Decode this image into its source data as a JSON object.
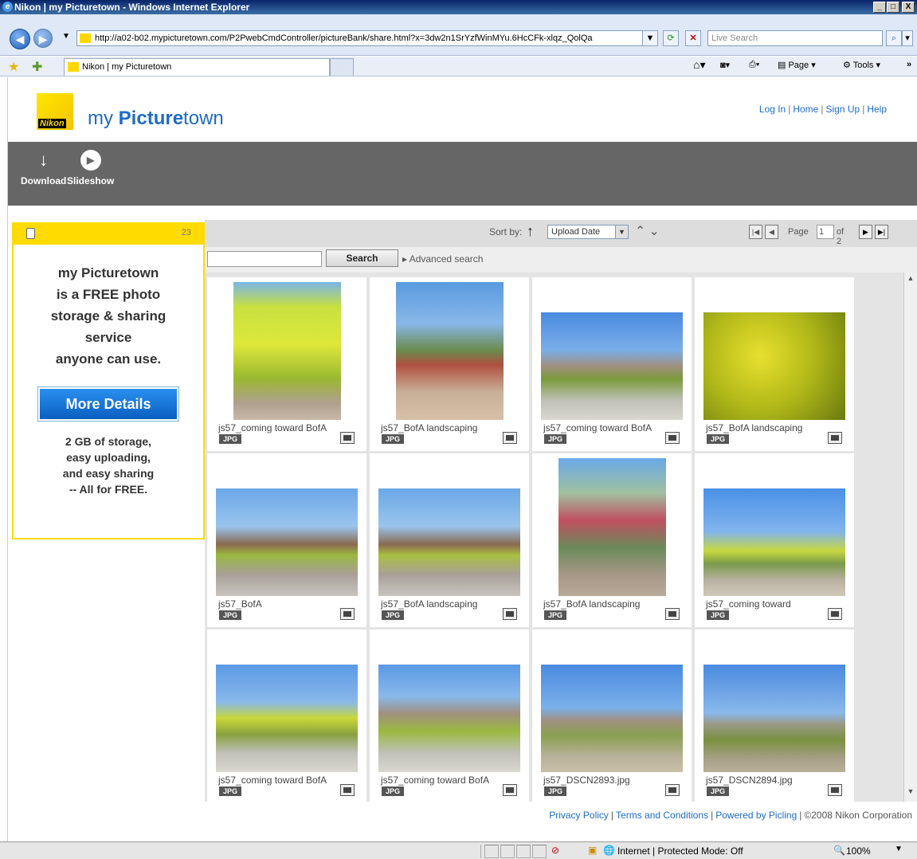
{
  "window": {
    "title": "Nikon | my Picturetown - Windows Internet Explorer",
    "minimize": "_",
    "maximize": "□",
    "close": "X"
  },
  "browser": {
    "url": "http://a02-b02.mypicturetown.com/P2PwebCmdController/pictureBank/share.html?x=3dw2n1SrYzfWinMYu.6HcCFk-xlqz_QolQa",
    "search_placeholder": "Live Search",
    "tab_title": "Nikon | my Picturetown",
    "page_menu": "Page",
    "tools_menu": "Tools"
  },
  "site": {
    "logo_text": "Nikon",
    "brand_prefix": "my ",
    "brand_bold": "Picture",
    "brand_suffix": "town",
    "links": {
      "login": "Log In",
      "home": "Home",
      "signup": "Sign Up",
      "help": "Help"
    }
  },
  "toolbar": {
    "download_label": "Download",
    "slideshow_label": "Slideshow"
  },
  "sidebar": {
    "count": "23",
    "promo_lines": [
      "my Picturetown",
      "is a FREE photo",
      "storage & sharing",
      "service",
      "anyone can use."
    ],
    "more_button": "More Details",
    "info_lines": [
      "2 GB of storage,",
      "easy uploading,",
      "and easy sharing",
      "-- All for FREE."
    ]
  },
  "sort": {
    "label": "Sort by:",
    "selected": "Upload Date"
  },
  "pager": {
    "page_label": "Page",
    "current": "1",
    "of_label": "of 2"
  },
  "search": {
    "button": "Search",
    "advanced": "Advanced search"
  },
  "photos": [
    {
      "caption": "js57_coming toward BofA",
      "type": "JPG"
    },
    {
      "caption": "js57_BofA landscaping",
      "type": "JPG"
    },
    {
      "caption": "js57_coming toward BofA",
      "type": "JPG"
    },
    {
      "caption": "js57_BofA landscaping",
      "type": "JPG"
    },
    {
      "caption": "js57_BofA",
      "type": "JPG"
    },
    {
      "caption": "js57_BofA landscaping",
      "type": "JPG"
    },
    {
      "caption": "js57_BofA landscaping",
      "type": "JPG"
    },
    {
      "caption": "js57_coming toward",
      "type": "JPG"
    },
    {
      "caption": "js57_coming toward BofA",
      "type": "JPG"
    },
    {
      "caption": "js57_coming toward BofA",
      "type": "JPG"
    },
    {
      "caption": "js57_DSCN2893.jpg",
      "type": "JPG"
    },
    {
      "caption": "js57_DSCN2894.jpg",
      "type": "JPG"
    }
  ],
  "footer": {
    "privacy": "Privacy Policy",
    "terms": "Terms and Conditions",
    "powered": "Powered by Picling",
    "copyright": "©2008 Nikon Corporation"
  },
  "status": {
    "zone": "Internet | Protected Mode: Off",
    "zoom": "100%"
  },
  "colors": {
    "accent": "#1e6cc8",
    "sidebar_yellow": "#ffdb00",
    "toolbar_gray": "#666666"
  }
}
